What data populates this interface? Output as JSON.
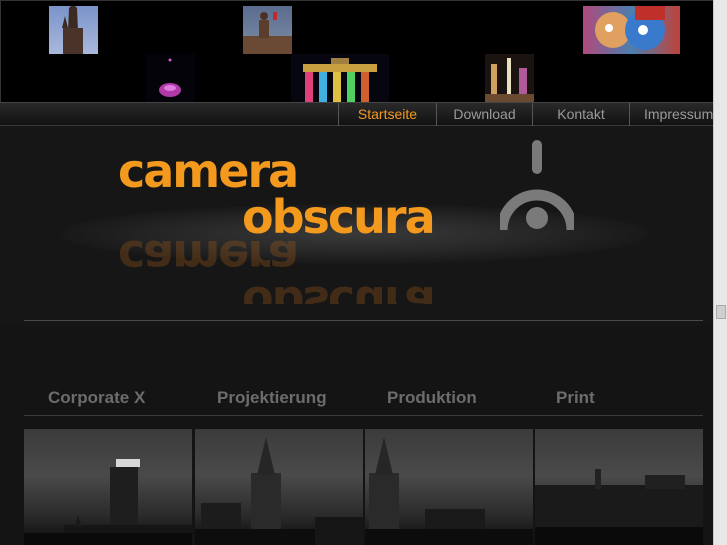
{
  "nav": {
    "items": [
      {
        "label": "Startseite",
        "active": true
      },
      {
        "label": "Download",
        "active": false
      },
      {
        "label": "Kontakt",
        "active": false
      },
      {
        "label": "Impressum",
        "active": false
      }
    ]
  },
  "logo": {
    "line1": "camera",
    "line2": "obscura",
    "color": "#f39a1e"
  },
  "categories": [
    {
      "label": "Corporate X"
    },
    {
      "label": "Projektierung"
    },
    {
      "label": "Produktion"
    },
    {
      "label": "Print"
    }
  ],
  "thumbnails": [
    {
      "icon": "cathedral-photo"
    },
    {
      "icon": "monument-photo"
    },
    {
      "icon": "graffiti-photo"
    },
    {
      "icon": "light-show-photo"
    },
    {
      "icon": "brandenburg-gate-photo"
    },
    {
      "icon": "illuminated-street-photo"
    }
  ],
  "colors": {
    "accent": "#f39a1e",
    "nav_text": "#9a9a9a",
    "category_text": "#6c6c6c"
  }
}
